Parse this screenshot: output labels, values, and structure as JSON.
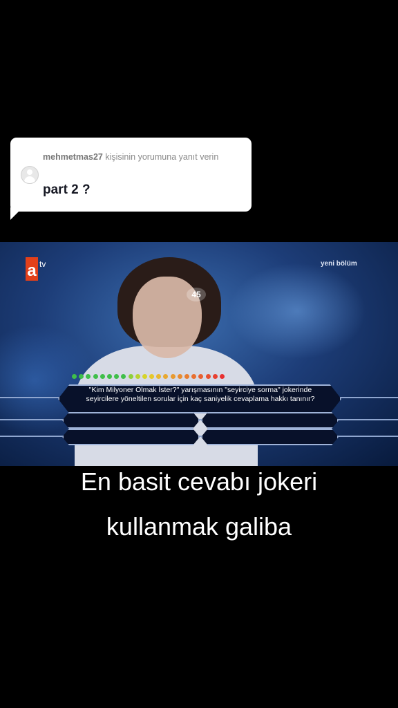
{
  "reply": {
    "username": "mehmetmas27",
    "header_text": " kişisinin yorumuna yanıt verin",
    "comment": "part 2 ?"
  },
  "video": {
    "channel_logo": "a",
    "channel_suffix": "tv",
    "badge": "yeni bölüm",
    "timer": "45",
    "question": "\"Kim Milyoner Olmak İster?\" yarışmasının \"seyirciye sorma\" jokerinde seyircilere yöneltilen sorular için kaç saniyelik cevaplama hakkı tanınır?",
    "ladder_colors": [
      "#3fbf4a",
      "#3fbf4a",
      "#3fbf4a",
      "#3fbf4a",
      "#3fbf4a",
      "#3fbf4a",
      "#3fbf4a",
      "#3fbf4a",
      "#8fcf3a",
      "#b8d230",
      "#d6d42a",
      "#e6c82a",
      "#e8b830",
      "#e8a830",
      "#e89a30",
      "#e88c30",
      "#e87e30",
      "#e87030",
      "#e86030",
      "#e85030",
      "#e84030",
      "#e83030"
    ]
  },
  "caption": {
    "line1": "En basit cevabı jokeri",
    "line2": "kullanmak galiba"
  }
}
